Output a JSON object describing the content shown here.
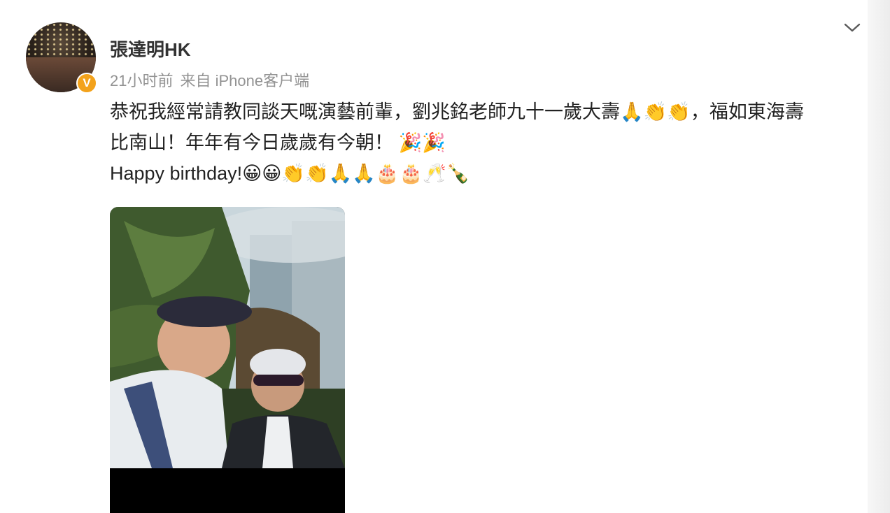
{
  "post": {
    "author": "張達明HK",
    "time": "21小时前",
    "source": "来自 iPhone客户端",
    "text_line1": "恭祝我經常請教同談天嘅演藝前輩，劉兆銘老師九十一歲大壽🙏👏👏，福如東海壽",
    "text_line2": "比南山！年年有今日歲歲有今朝！ 🎉🎉",
    "text_line3": "Happy birthday!😀😀👏👏🙏🙏🎂🎂🥂🍾",
    "verified_mark": "V"
  },
  "icons": {
    "menu": "chevron-down-icon",
    "badge": "verified-badge-icon"
  },
  "colors": {
    "verified": "#f3a21b",
    "meta_text": "#939393",
    "chevron": "#5a5a5a"
  }
}
